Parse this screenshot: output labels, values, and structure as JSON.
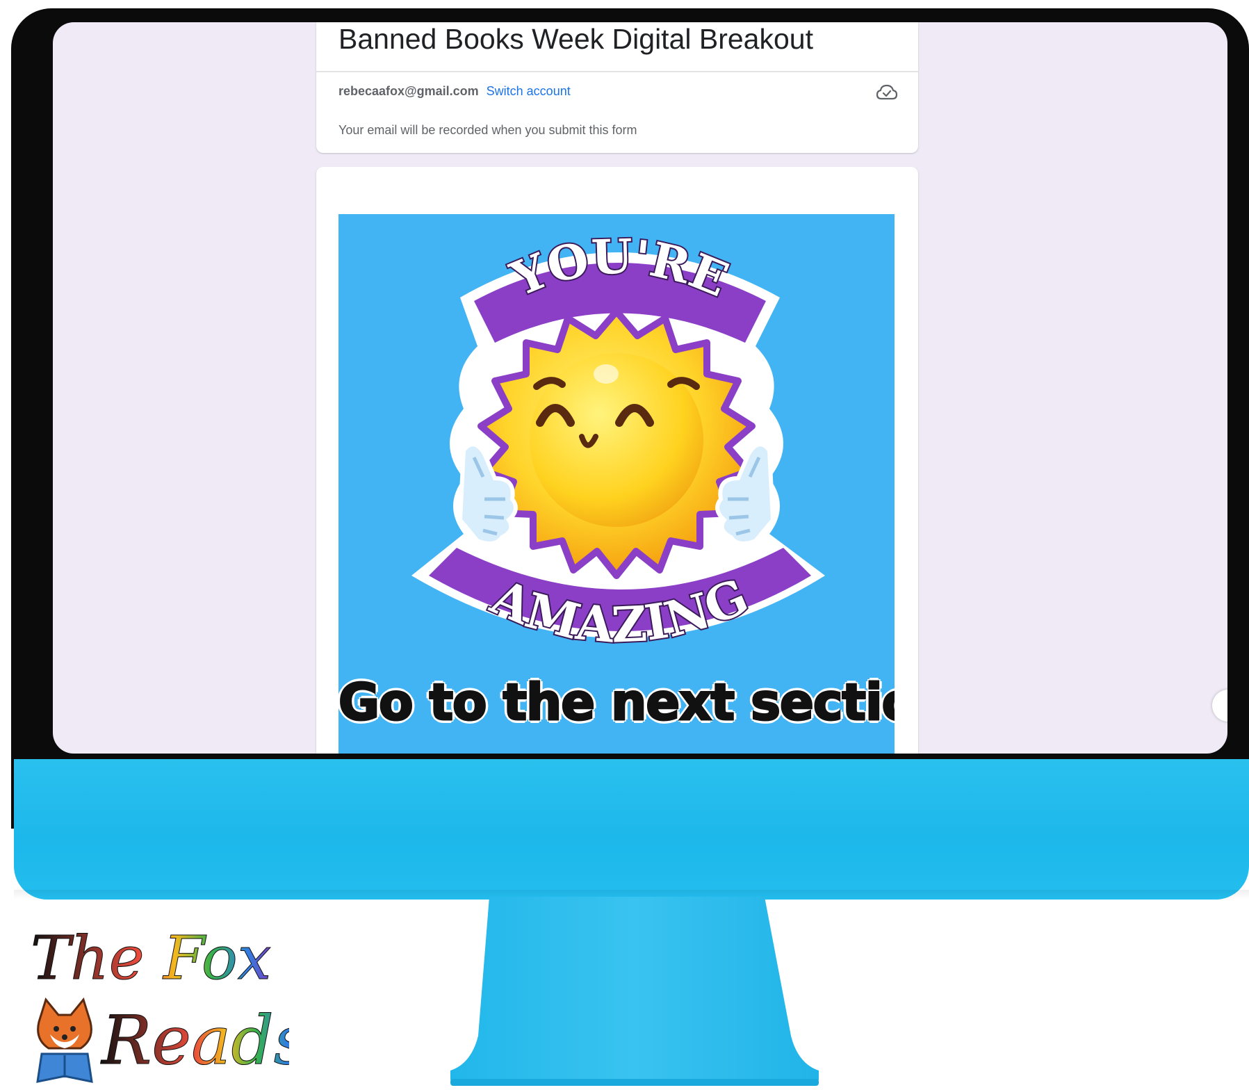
{
  "form": {
    "title": "Banned Books Week Digital Breakout",
    "account_email": "rebecaafox@gmail.com",
    "switch_account_label": "Switch account",
    "record_notice": "Your email will be recorded when you submit this form",
    "cloud_icon": "cloud-saved-icon"
  },
  "promo_image": {
    "banner_top": "YOU'RE",
    "banner_bottom": "AMAZING",
    "caption": "Go to the next section"
  },
  "logo": {
    "line1": "The Fox",
    "line2": "Reads"
  },
  "colors": {
    "screen_bg": "#efeaf6",
    "promo_bg": "#42b4f4",
    "monitor_blue": "#1db8eb",
    "link_blue": "#1a73e8"
  }
}
